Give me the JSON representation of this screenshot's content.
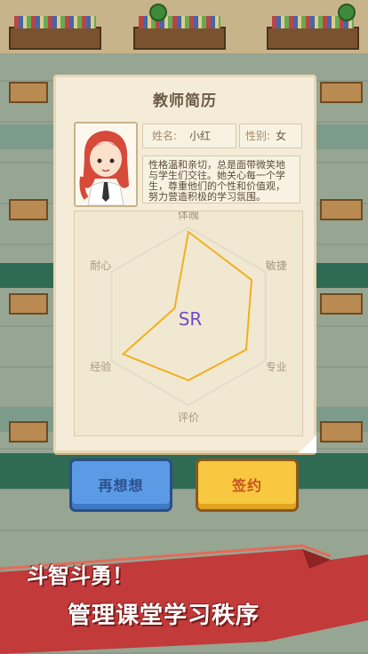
{
  "card": {
    "title": "教师简历",
    "name_label": "姓名:",
    "name_value": "小红",
    "gender_label": "性别:",
    "gender_value": "女",
    "bio": "性格温和亲切，总是面带微笑地与学生们交往。她关心每一个学生，尊重他们的个性和价值观，努力营造积极的学习氛围。",
    "rarity": "SR"
  },
  "radar": {
    "axes": [
      "体魄",
      "敏捷",
      "专业",
      "评价",
      "经验",
      "耐心"
    ],
    "values": [
      0.95,
      0.82,
      0.75,
      0.72,
      0.85,
      0.18
    ],
    "line_color": "#f0b020",
    "rarity_color": "#6a4fc4"
  },
  "buttons": {
    "rethink": "再想想",
    "sign": "签约"
  },
  "banner": {
    "line1": "斗智斗勇！",
    "line2": "管理课堂学习秩序",
    "color": "#c23a3a"
  }
}
